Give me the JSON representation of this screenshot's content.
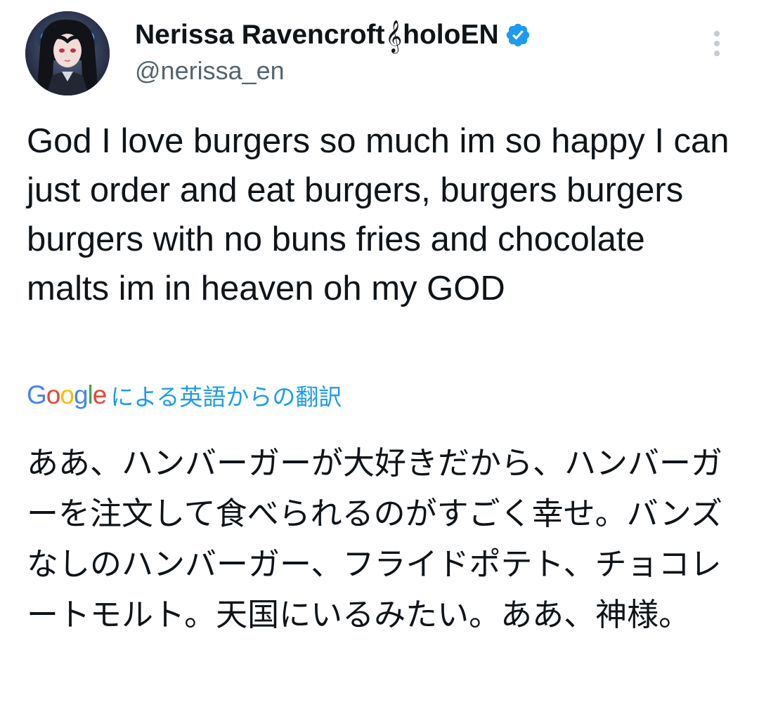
{
  "author": {
    "display_name_part1": "Nerissa Ravencroft",
    "clef_symbol": "𝄞",
    "display_name_part2": "holoEN",
    "handle": "@nerissa_en",
    "verified": true,
    "verified_color": "#1d9bf0"
  },
  "menu": {
    "icon": "more-vertical-icon"
  },
  "tweet": {
    "text": "God I love burgers so much im so happy I can just order and eat burgers, burgers burgers burgers with no buns fries and chocolate malts im in heaven oh my GOD"
  },
  "translation": {
    "logo_letters": [
      "G",
      "o",
      "o",
      "g",
      "l",
      "e"
    ],
    "label": "による英語からの翻訳",
    "label_color": "#1d9bf0",
    "text": "ああ、ハンバーガーが大好きだから、ハンバーガーを注文して食べられるのがすごく幸せ。バンズなしのハンバーガー、フライドポテト、チョコレートモルト。天国にいるみたい。ああ、神様。"
  },
  "colors": {
    "text_primary": "#0f1419",
    "text_secondary": "#536471",
    "accent": "#1d9bf0"
  }
}
